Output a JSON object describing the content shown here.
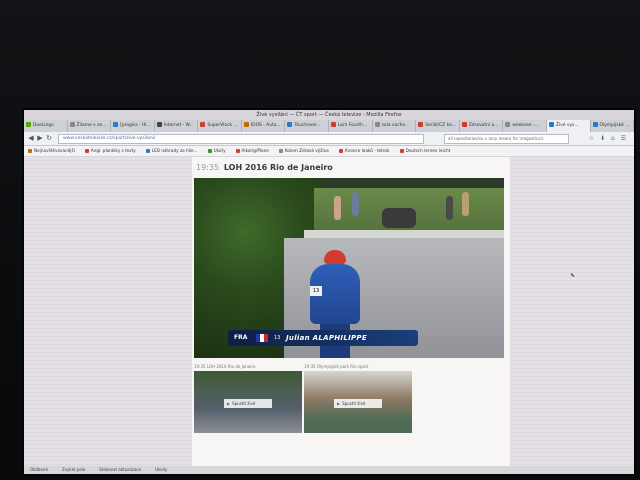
{
  "window": {
    "title": "Živé vysílání — ČT sport — Česká televize - Mozilla Firefox"
  },
  "tabs": [
    {
      "label": "DuoLingo",
      "color": "#58a700"
    },
    {
      "label": "Žilame v ze...",
      "color": "#888888"
    },
    {
      "label": "[progiss - Hl...",
      "color": "#2b7ac9"
    },
    {
      "label": "Internet - W...",
      "color": "#444444"
    },
    {
      "label": "SuperVlock ...",
      "color": "#d23b2f"
    },
    {
      "label": "IDOS - Auto...",
      "color": "#c46a00"
    },
    {
      "label": "Touchover...",
      "color": "#2b7ac9"
    },
    {
      "label": "Lom Fourth...",
      "color": "#d23b2f"
    },
    {
      "label": "sola vache...",
      "color": "#888888"
    },
    {
      "label": "Seriál/CZ ke...",
      "color": "#d23b2f"
    },
    {
      "label": "Zdravotní a...",
      "color": "#d23b2f"
    },
    {
      "label": "weeksee -...",
      "color": "#888888"
    },
    {
      "label": "Živé vys...",
      "color": "#2b7ac9",
      "active": true
    },
    {
      "label": "Olympijské ...",
      "color": "#2b7ac9"
    }
  ],
  "navbar": {
    "url": "www.ceskatelevize.cz/sport/zive-vysilani/",
    "search_text": "all repositories/su x (any mean) for irregastics/c",
    "back_glyph": "◀",
    "forward_glyph": "▶",
    "reload_glyph": "↻",
    "icons_text": "☆ ⬇ ⌂ ☰"
  },
  "bookmarks": [
    {
      "label": "Nejnavštěvovanější",
      "color": "#c46a00"
    },
    {
      "label": "Angl. plankiky s texty",
      "color": "#d23b2f"
    },
    {
      "label": "LED náhrady za hlíe...",
      "color": "#2b7ac9"
    },
    {
      "label": "Ukoľy",
      "color": "#3c8d2f"
    },
    {
      "label": "Alkoríg/Plane",
      "color": "#d23b2f"
    },
    {
      "label": "Kolem Zdravá výživa",
      "color": "#888888"
    },
    {
      "label": "Anonce leaků - telesk",
      "color": "#d23b2f"
    },
    {
      "label": "Deutsch lernen leicht",
      "color": "#d23b2f"
    }
  ],
  "stream": {
    "time": "19:35",
    "title": "LOH 2016 Rio de Janeiro",
    "lower_third": {
      "country": "FRA",
      "bib": "13",
      "rider_name": "Julian ALAPHILIPPE"
    },
    "rider_bib_number": "13"
  },
  "thumbnails": [
    {
      "label": "19:35 LOH 2016 Rio de Janeiro",
      "button": "Spustit živě",
      "active": true
    },
    {
      "label": "19:35 Olympijské park Rio sport",
      "button": "Spustit živě",
      "active": false
    }
  ],
  "statusbar": {
    "items": [
      "Oblíbené",
      "Zvyklé pole",
      "Stahovat aktualizace",
      "Ukolly"
    ]
  },
  "colors": {
    "brand_blue": "#1b3f7a",
    "jersey_blue": "#2f5fb9",
    "helmet_red": "#d23b2f"
  }
}
